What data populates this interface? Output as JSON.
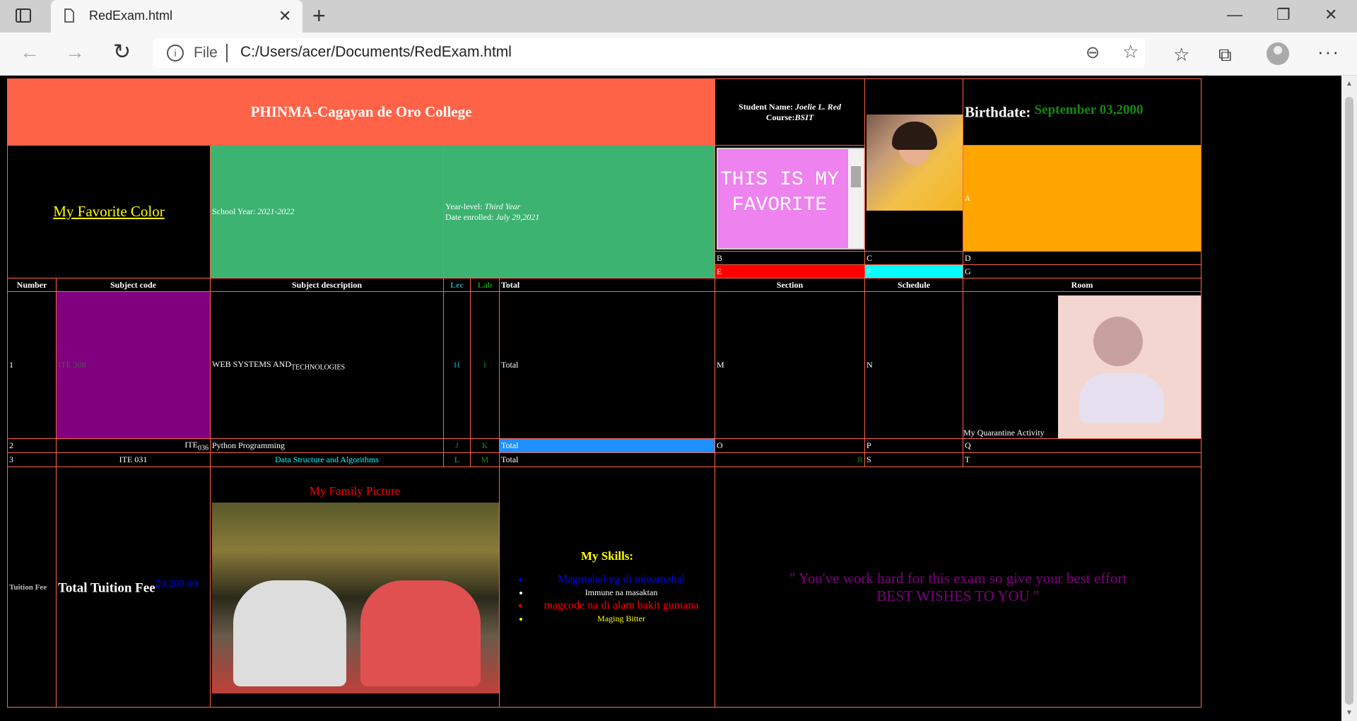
{
  "browser": {
    "tab_title": "RedExam.html",
    "close_tab": "✕",
    "new_tab": "+",
    "address_label": "File",
    "url": "C:/Users/acer/Documents/RedExam.html",
    "minimize": "—",
    "maximize": "❐",
    "close": "✕"
  },
  "header": {
    "college": "PHINMA-Cagayan de Oro College",
    "student_name_label": "Student Name:",
    "student_name": "Joelie L. Red",
    "course_label": "Course:",
    "course": "BSIT",
    "birthdate_label": "Birthdate:",
    "birthdate": "September 03,2000"
  },
  "info": {
    "favorite_color": "My Favorite Color",
    "school_year_label": "School Year:",
    "school_year": "2021-2022",
    "year_level_label": "Year-level:",
    "year_level": "Third Year",
    "date_enrolled_label": "Date enrolled:",
    "date_enrolled": "July 29,2021",
    "marquee": "THIS IS MY FAVORITE",
    "cell_a": "A",
    "cell_b": "B",
    "cell_c": "C",
    "cell_d": "D",
    "cell_e": "E",
    "cell_f": "F",
    "cell_g": "G"
  },
  "subjects": {
    "headers": [
      "Number",
      "Subject code",
      "Subject description",
      "Lec",
      "Lab",
      "Total",
      "Section",
      "Schedule",
      "Room"
    ],
    "row1": {
      "num": "1",
      "code": "ITE 308",
      "desc_main": "WEB SYSTEMS AND",
      "desc_sub": "TECHNOLOGIES",
      "lec": "H",
      "lab": "I",
      "total": "Total",
      "section": "M",
      "schedule": "N",
      "room_caption": "My Quarantine Activity"
    },
    "row2": {
      "num": "2",
      "code_main": "ITE",
      "code_sub": "036",
      "desc": "Python Programming",
      "lec": "J",
      "lab": "K",
      "total": "Total",
      "section": "O",
      "schedule": "P",
      "room": "Q"
    },
    "row3": {
      "num": "3",
      "code": "ITE 031",
      "desc": "Data Structure and Algorithms",
      "lec": "L",
      "lab": "M",
      "total": "Total",
      "section_r": "R",
      "schedule": "S",
      "room": "T"
    }
  },
  "bottom": {
    "tuition_small": "Tuition Fee",
    "tuition_big": "Total Tuition Fee",
    "tuition_amount": "20,209.00",
    "family_picture": "My Family Picture",
    "skills_title": "My Skills:",
    "skills": [
      {
        "text": "Magmahal ug di minamahal",
        "color": "#0000ff"
      },
      {
        "text": "Immune na masaktan",
        "color": "#ffffff"
      },
      {
        "text": "magcode na di alam bakit gumana",
        "color": "#ff0000"
      },
      {
        "text": "Maging Bitter",
        "color": "#ffff00"
      }
    ],
    "quote_line1": "\" You've work hard for this exam so give your best effort",
    "quote_line2": "BEST WISHES TO YOU \""
  },
  "colors": {
    "header_bg": "#ff6347",
    "green_cell": "#3cb371",
    "orange_cell": "#ffa500",
    "purple_cell": "#800080",
    "red_cell": "#ff0000",
    "cyan_cell": "#00ffff",
    "blue_total": "#1e90ff"
  }
}
